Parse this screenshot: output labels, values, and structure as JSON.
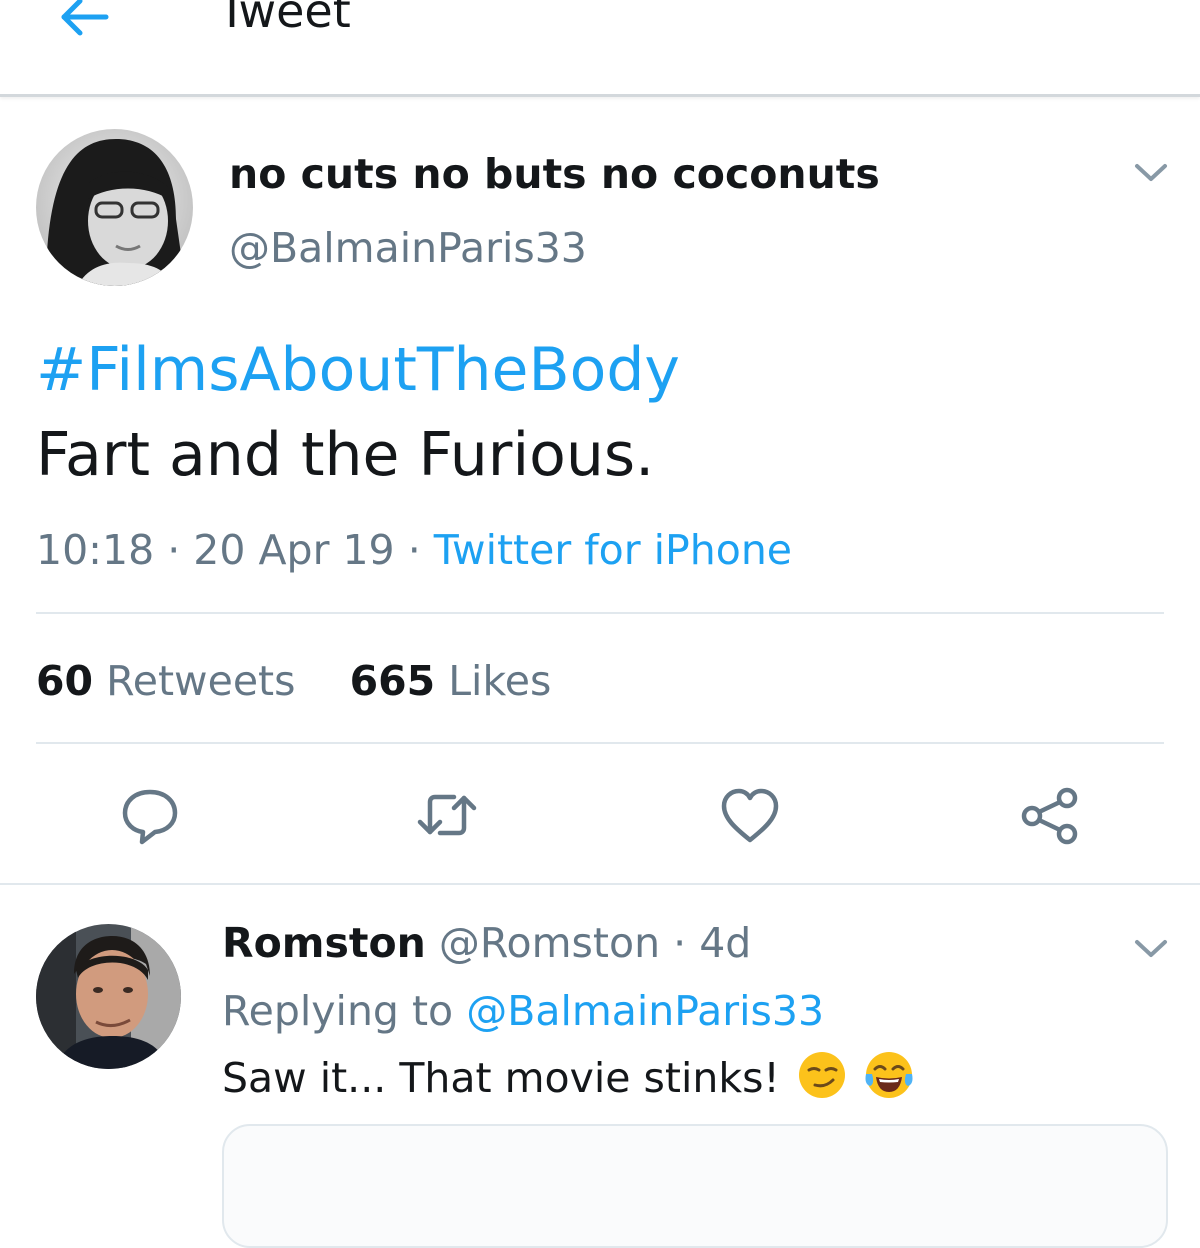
{
  "header": {
    "title": "Tweet",
    "back_icon": "back-arrow-icon"
  },
  "tweet": {
    "author_name": "no cuts no buts no coconuts",
    "author_handle": "@BalmainParis33",
    "hashtag": "#FilmsAboutTheBody",
    "text": "Fart and the Furious.",
    "time": "10:18",
    "date": "20 Apr 19",
    "separator": "·",
    "source": "Twitter for iPhone",
    "retweets_count": "60",
    "retweets_label": "Retweets",
    "likes_count": "665",
    "likes_label": "Likes",
    "actions": [
      "reply-icon",
      "retweet-icon",
      "like-icon",
      "share-icon"
    ]
  },
  "reply": {
    "author_name": "Romston",
    "author_handle": "@Romston",
    "separator": "·",
    "age": "4d",
    "replying_prefix": "Replying to",
    "replying_handle": "@BalmainParis33",
    "text": "Saw it... That movie stinks!",
    "emojis": [
      "smirking-face-emoji",
      "tears-of-joy-emoji"
    ]
  },
  "colors": {
    "accent": "#1da1f2",
    "secondary_text": "#657786",
    "primary_text": "#14171a",
    "divider": "#e1e8ed"
  }
}
